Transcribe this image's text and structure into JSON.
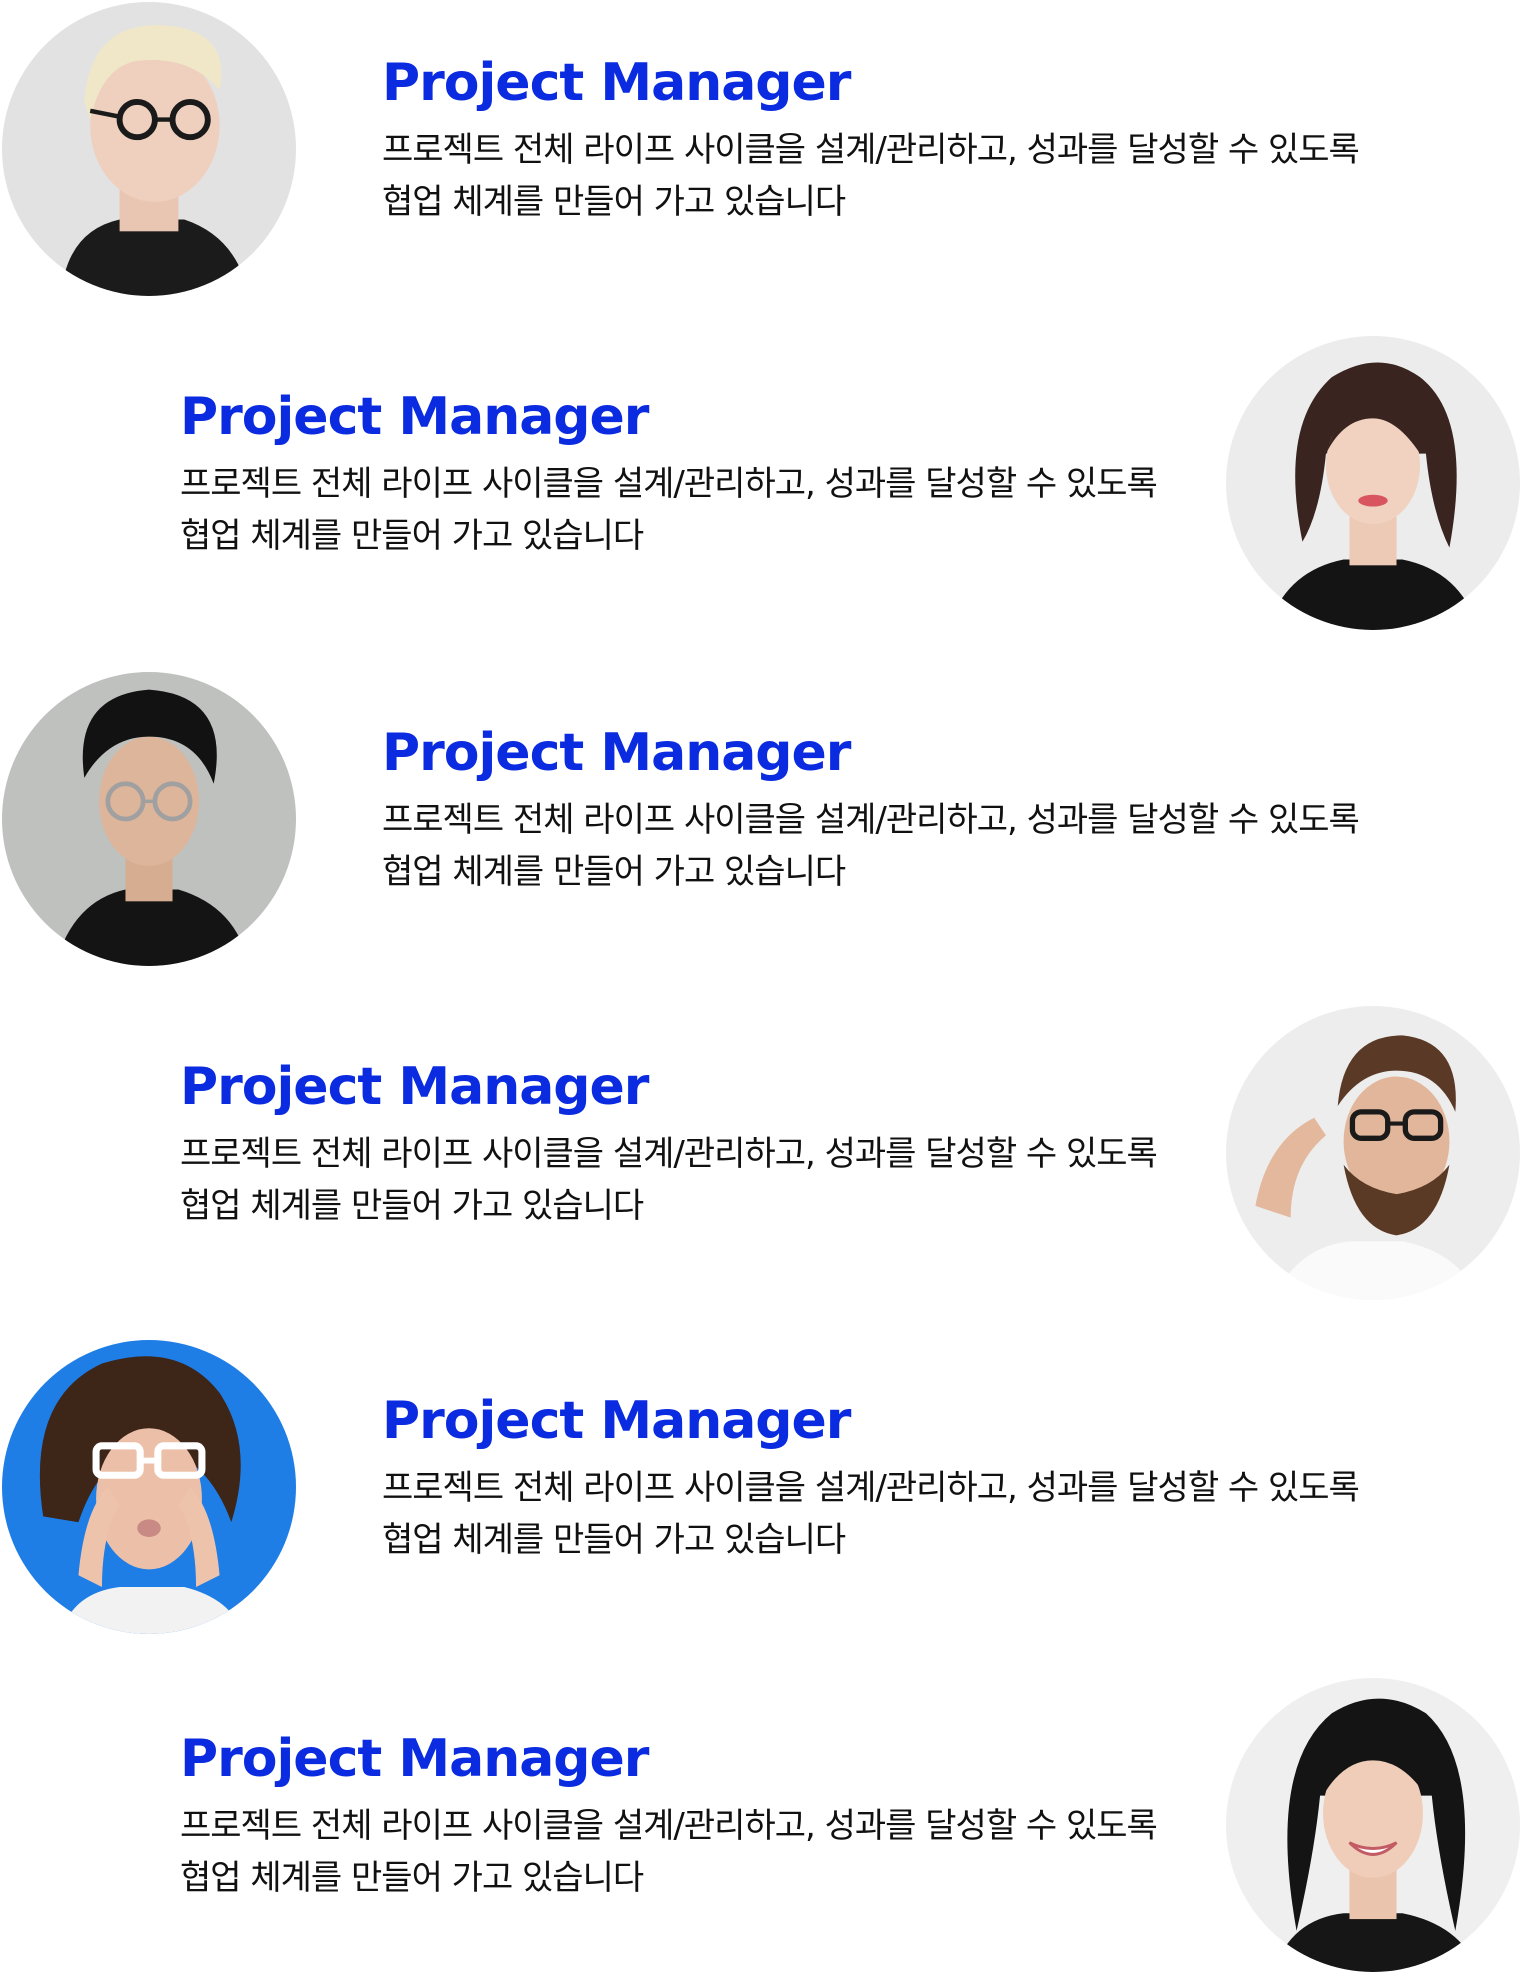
{
  "theme": {
    "title_color": "#0a2be0",
    "text_color": "#111111",
    "background": "#ffffff"
  },
  "members": [
    {
      "title": "Project Manager",
      "description": "프로젝트 전체 라이프 사이클을 설계/관리하고, 성과를 달성할 수 있도록 협업 체계를 만들어 가고 있습니다",
      "photo": "woman-blonde-glasses-photo"
    },
    {
      "title": "Project Manager",
      "description": "프로젝트 전체 라이프 사이클을 설계/관리하고, 성과를 달성할 수 있도록 협업 체계를 만들어 가고 있습니다",
      "photo": "woman-brown-hair-photo"
    },
    {
      "title": "Project Manager",
      "description": "프로젝트 전체 라이프 사이클을 설계/관리하고, 성과를 달성할 수 있도록 협업 체계를 만들어 가고 있습니다",
      "photo": "man-glasses-black-hair-photo"
    },
    {
      "title": "Project Manager",
      "description": "프로젝트 전체 라이프 사이클을 설계/관리하고, 성과를 달성할 수 있도록 협업 체계를 만들어 가고 있습니다",
      "photo": "man-beard-glasses-photo"
    },
    {
      "title": "Project Manager",
      "description": "프로젝트 전체 라이프 사이클을 설계/관리하고, 성과를 달성할 수 있도록 협업 체계를 만들어 가고 있습니다",
      "photo": "woman-curly-hair-white-glasses-photo"
    },
    {
      "title": "Project Manager",
      "description": "프로젝트 전체 라이프 사이클을 설계/관리하고, 성과를 달성할 수 있도록 협업 체계를 만들어 가고 있습니다",
      "photo": "woman-smiling-black-hair-photo"
    }
  ]
}
